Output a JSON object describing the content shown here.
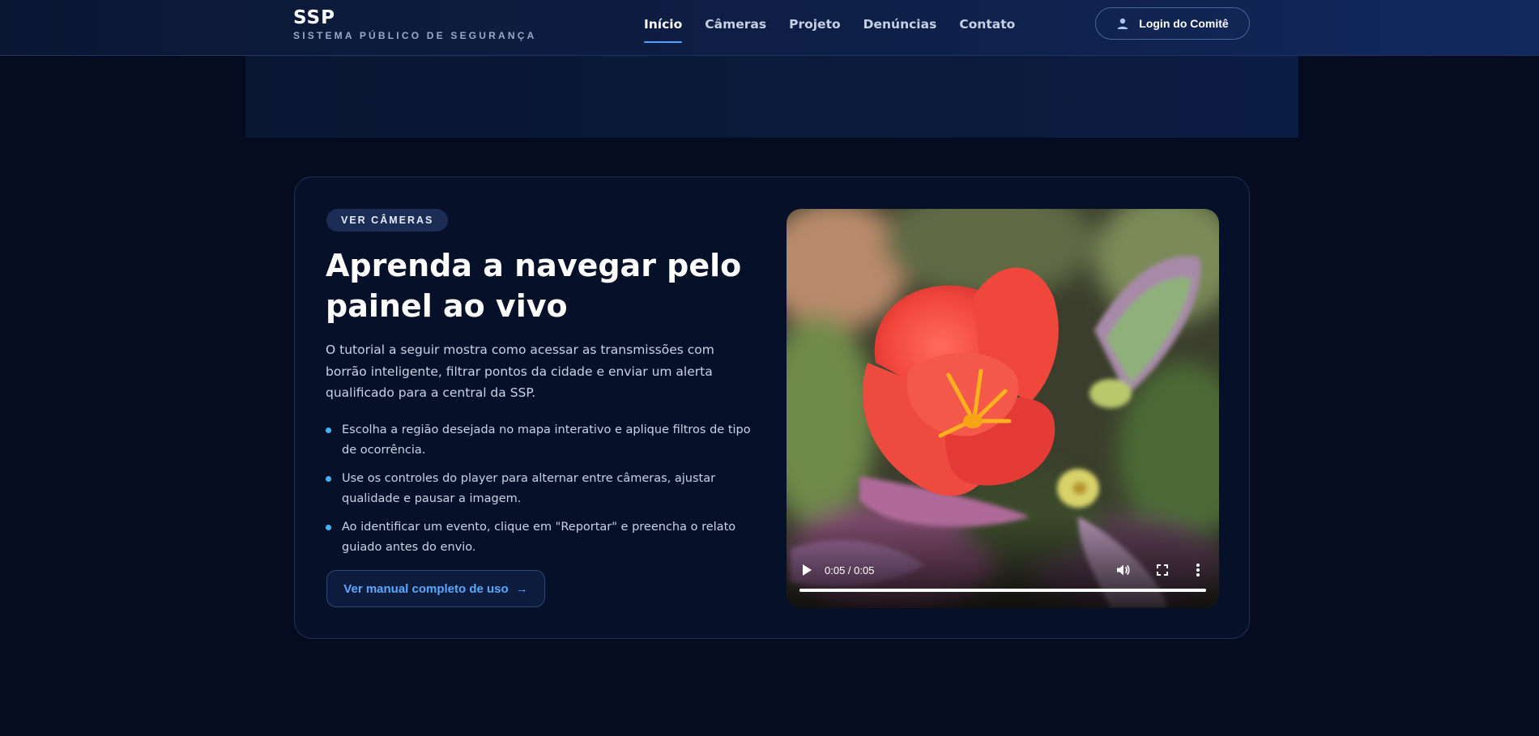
{
  "header": {
    "brand_name": "SSP",
    "brand_subtitle": "SISTEMA PÚBLICO DE SEGURANÇA",
    "nav": [
      {
        "label": "Início",
        "active": true
      },
      {
        "label": "Câmeras",
        "active": false
      },
      {
        "label": "Projeto",
        "active": false
      },
      {
        "label": "Denúncias",
        "active": false
      },
      {
        "label": "Contato",
        "active": false
      }
    ],
    "login_label": "Login do Comitê",
    "login_icon": "user-icon"
  },
  "tutorial": {
    "pill_label": "VER CÂMERAS",
    "title": "Aprenda a navegar pelo painel ao vivo",
    "description": "O tutorial a seguir mostra como acessar as transmissões com borrão inteligente, filtrar pontos da cidade e enviar um alerta qualificado para a central da SSP.",
    "steps": [
      "Escolha a região desejada no mapa interativo e aplique filtros de tipo de ocorrência.",
      "Use os controles do player para alternar entre câmeras, ajustar qualidade e pausar a imagem.",
      "Ao identificar um evento, clique em \"Reportar\" e preencha o relato guiado antes do envio."
    ],
    "manual_button": "Ver manual completo de uso",
    "manual_arrow": "→"
  },
  "video": {
    "time": "0:05 / 0:05",
    "progress": 1.0,
    "icons": [
      "play-icon",
      "volume-icon",
      "fullscreen-icon",
      "more-vert-icon"
    ]
  },
  "colors": {
    "accent": "#4fa3ff",
    "bullet": "#3fb5f5",
    "background": "#050c1f"
  }
}
